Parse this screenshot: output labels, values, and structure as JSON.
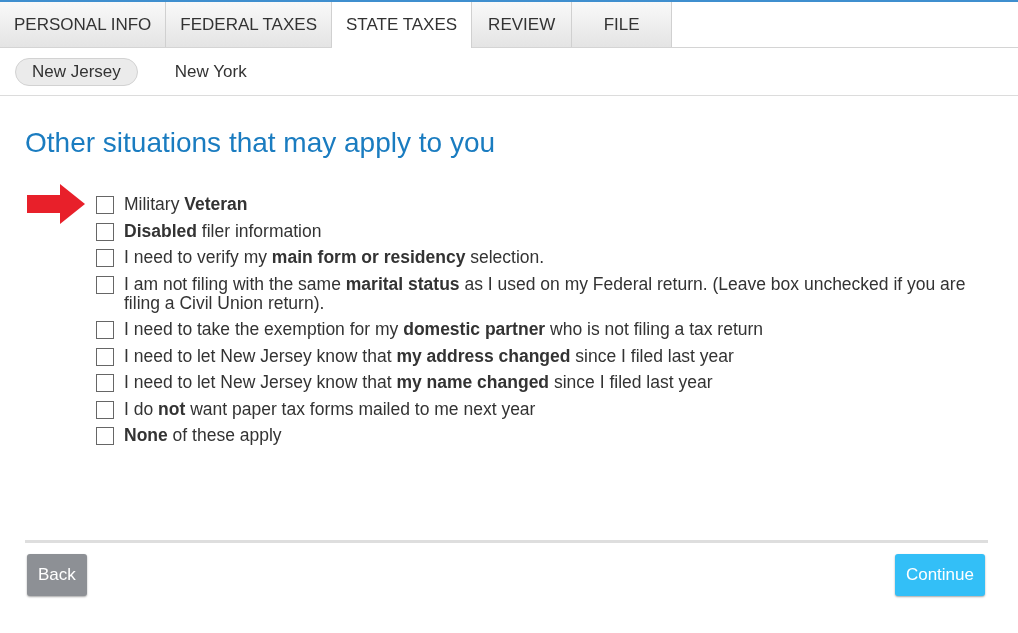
{
  "tabs": [
    {
      "label": "PERSONAL INFO",
      "selected": false
    },
    {
      "label": "FEDERAL TAXES",
      "selected": false
    },
    {
      "label": "STATE TAXES",
      "selected": true
    },
    {
      "label": "REVIEW",
      "selected": false
    },
    {
      "label": "FILE",
      "selected": false
    }
  ],
  "state_tabs": [
    {
      "label": "New Jersey",
      "selected": true
    },
    {
      "label": "New York",
      "selected": false
    }
  ],
  "heading": "Other situations that may apply to you",
  "options": [
    {
      "label": "Military **Veteran**",
      "checked": false,
      "flagged": true
    },
    {
      "label": "**Disabled** filer information",
      "checked": false,
      "flagged": false
    },
    {
      "label": "I need to verify my **main form or residency** selection.",
      "checked": false,
      "flagged": false
    },
    {
      "label": "I am not filing with the same **marital status** as I used on my Federal return. (Leave box unchecked if you are filing a Civil Union return).",
      "checked": false,
      "flagged": false
    },
    {
      "label": "I need to take the exemption for my **domestic partner** who is not filing a tax return",
      "checked": false,
      "flagged": false
    },
    {
      "label": "I need to let New Jersey know that **my address changed** since I filed last year",
      "checked": false,
      "flagged": false
    },
    {
      "label": "I need to let New Jersey know that **my name changed** since I filed last year",
      "checked": false,
      "flagged": false
    },
    {
      "label": "I do **not** want paper tax forms mailed to me next year",
      "checked": false,
      "flagged": false
    },
    {
      "label": "**None** of these apply",
      "checked": false,
      "flagged": false
    }
  ],
  "buttons": [
    {
      "label": "Back",
      "kind": "back"
    },
    {
      "label": "Continue",
      "kind": "continue"
    }
  ]
}
